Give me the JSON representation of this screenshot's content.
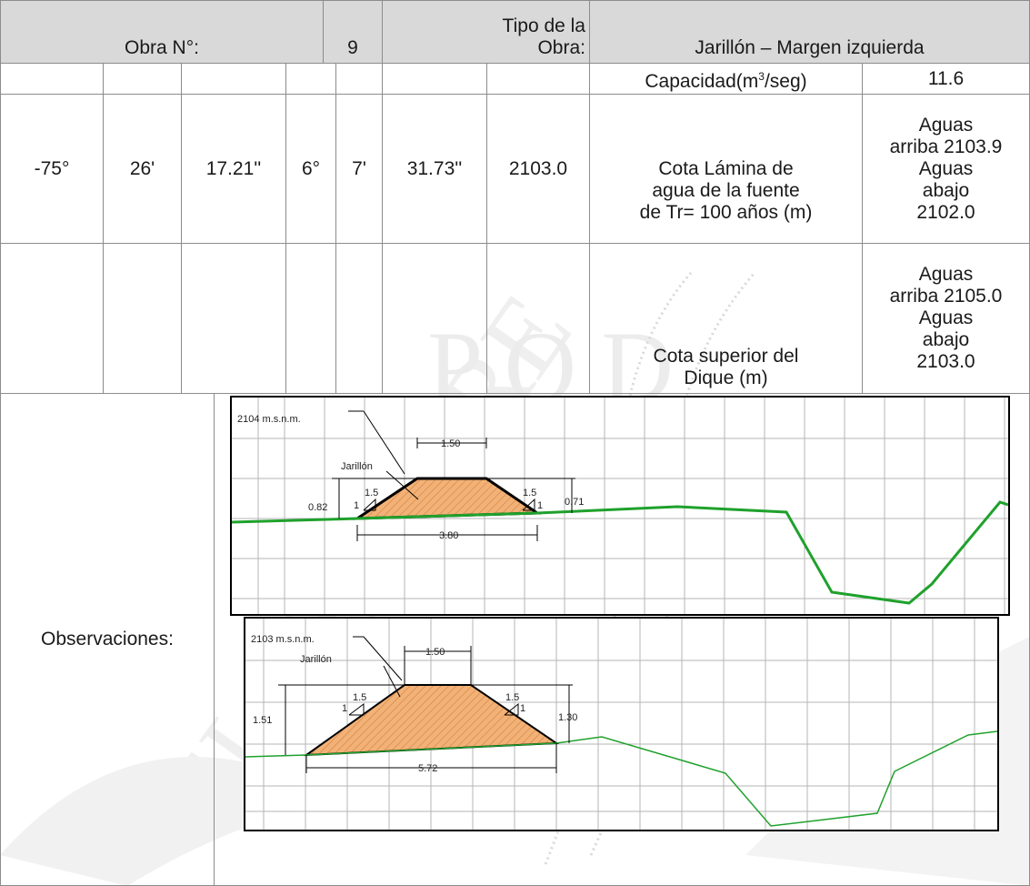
{
  "header": {
    "obra_label": "Obra N°:",
    "obra_number": "9",
    "tipo_label_line1": "Tipo de la",
    "tipo_label_line2": "Obra:",
    "tipo_value": "Jarillón – Margen izquierda"
  },
  "capacidad": {
    "label_prefix": "Capacidad(m",
    "label_sup": "3",
    "label_suffix": "/seg)",
    "value": "11.6"
  },
  "coordinates": {
    "lon_deg": "-75°",
    "lon_min": "26'",
    "lon_sec": "17.21''",
    "lat_deg": "6°",
    "lat_min": "7'",
    "lat_sec": "31.73''",
    "elevation": "2103.0"
  },
  "lamina": {
    "label_line1": "Cota Lámina de",
    "label_line2": "agua de la fuente",
    "label_line3": "de Tr= 100 años (m)",
    "value_line1": "Aguas",
    "value_line2": "arriba 2103.9",
    "value_line3": "Aguas",
    "value_line4": "abajo",
    "value_line5": "2102.0"
  },
  "dique": {
    "label_line1": "Cota superior del",
    "label_line2": "Dique (m)",
    "value_line1": "Aguas",
    "value_line2": "arriba 2105.0",
    "value_line3": "Aguas",
    "value_line4": "abajo",
    "value_line5": "2103.0"
  },
  "observaciones": {
    "label": "Observaciones:"
  },
  "section1": {
    "elevation_label": "2104 m.s.n.m.",
    "jarillon_label": "Jarillón",
    "crest_width": "1.50",
    "base_width": "3.80",
    "left_height": "0.82",
    "right_height": "0.71",
    "slope_h": "1.5",
    "slope_v": "1"
  },
  "section2": {
    "elevation_label": "2103 m.s.n.m.",
    "jarillon_label": "Jarillón",
    "crest_width": "1.50",
    "base_width": "5.72",
    "left_height": "1.51",
    "right_height": "1.30",
    "slope_h": "1.5",
    "slope_v": "1"
  },
  "colors": {
    "header_bg": "#d9d9d9",
    "terrain": "#1fa12c",
    "fill": "#f2b277",
    "hatch": "#d9884a",
    "watermark": "#bdbdbd"
  }
}
